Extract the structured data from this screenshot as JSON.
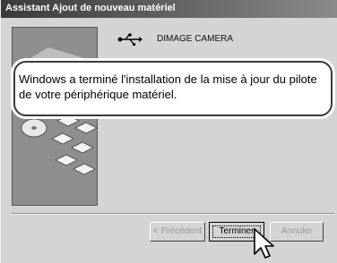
{
  "window": {
    "title": "Assistant Ajout de nouveau matériel"
  },
  "device": {
    "name": "DIMAGE CAMERA",
    "icon": "usb-icon"
  },
  "message": {
    "line1": "Windows a terminé l'installation de la mise à jour du pilote",
    "line2": "de votre périphérique matériel."
  },
  "buttons": {
    "prev": "< Précédent",
    "finish": "Terminer",
    "cancel": "Annuler"
  },
  "colors": {
    "titlebar_left": "#3a3a3a",
    "titlebar_right": "#8a8a8a",
    "dialog_bg": "#d4d4d4"
  }
}
